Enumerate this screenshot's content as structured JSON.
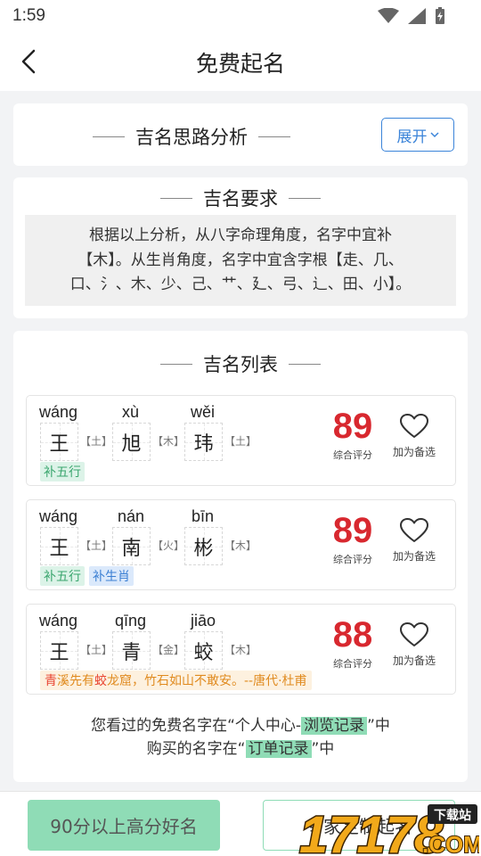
{
  "status": {
    "time": "1:59"
  },
  "nav": {
    "title": "免费起名"
  },
  "analysis": {
    "title": "吉名思路分析",
    "expand_label": "展开"
  },
  "requirement": {
    "title": "吉名要求",
    "line1": "根据以上分析，从八字命理角度，名字中宜补",
    "line2": "【木】。从生肖角度，名字中宜含字根【走、几、",
    "line3": "口、氵、木、少、己、艹、廴、弓、辶、田、小】。"
  },
  "list": {
    "title": "吉名列表",
    "score_label": "综合评分",
    "fav_label": "加为备选",
    "names": [
      {
        "chars": [
          {
            "pinyin": "wáng",
            "char": "王",
            "element": "【土】"
          },
          {
            "pinyin": "xù",
            "char": "旭",
            "element": "【木】"
          },
          {
            "pinyin": "wěi",
            "char": "玮",
            "element": "【土】"
          }
        ],
        "score": "89",
        "tags": [
          "补五行"
        ]
      },
      {
        "chars": [
          {
            "pinyin": "wáng",
            "char": "王",
            "element": "【土】"
          },
          {
            "pinyin": "nán",
            "char": "南",
            "element": "【火】"
          },
          {
            "pinyin": "bīn",
            "char": "彬",
            "element": "【木】"
          }
        ],
        "score": "89",
        "tags": [
          "补五行",
          "补生肖"
        ]
      },
      {
        "chars": [
          {
            "pinyin": "wáng",
            "char": "王",
            "element": "【土】"
          },
          {
            "pinyin": "qīng",
            "char": "青",
            "element": "【金】"
          },
          {
            "pinyin": "jiāo",
            "char": "蛟",
            "element": "【木】"
          }
        ],
        "score": "88",
        "poem": {
          "hl1": "青",
          "part1": "溪先有",
          "hl2": "蛟",
          "part2": "龙窟，竹石如山不敢安。--唐代·杜甫"
        }
      }
    ]
  },
  "notice": {
    "line1_pre": "您看过的免费名字在“个人中心-",
    "line1_hl": "浏览记录",
    "line1_post": "”中",
    "line2_pre": "购买的名字在“",
    "line2_hl": "订单记录",
    "line2_post": "”中"
  },
  "bottom": {
    "high_score_label": "90分以上高分好名",
    "expert_label": "专家定制起名"
  },
  "watermark": {
    "text1": "17178",
    "text2": "下载站",
    "text3": ".COM"
  },
  "colors": {
    "accent_green": "#8fdcb6",
    "score_red": "#d8282f",
    "link_blue": "#3b84d9"
  }
}
